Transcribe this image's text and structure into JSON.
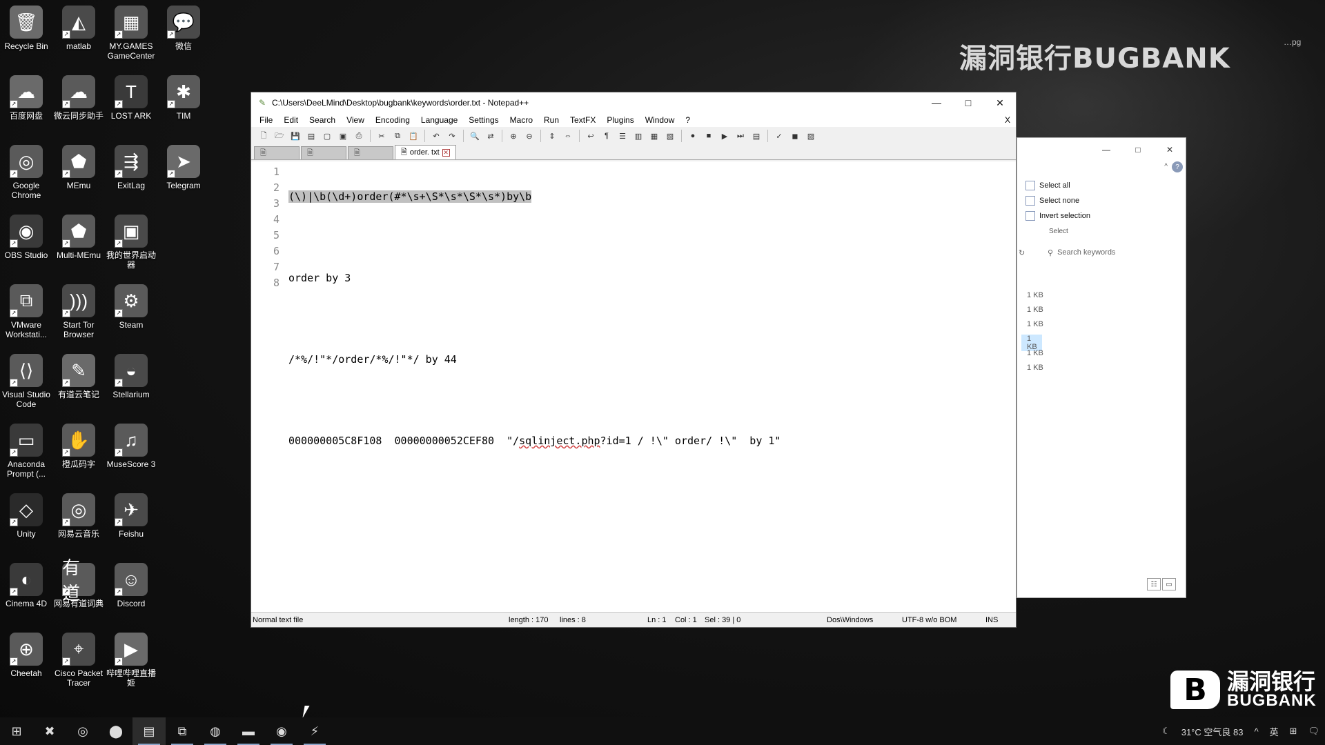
{
  "desktop": {
    "brand": "漏洞银行BUGBANK",
    "badge": "…pg",
    "icons": [
      {
        "label": "Recycle Bin",
        "icon": "recycle-bin-icon",
        "glyph": "🗑",
        "color": "#6b6b6b"
      },
      {
        "label": "matlab",
        "icon": "matlab-icon",
        "glyph": "◭",
        "color": "#4a4a4a"
      },
      {
        "label": "MY.GAMES GameCenter",
        "icon": "mygames-icon",
        "glyph": "▦",
        "color": "#555"
      },
      {
        "label": "微信",
        "icon": "wechat-icon",
        "glyph": "💬",
        "color": "#4a4a4a"
      },
      {
        "label": "百度网盘",
        "icon": "baidu-netdisk-icon",
        "glyph": "☁",
        "color": "#6a6a6a"
      },
      {
        "label": "微云同步助手",
        "icon": "weiyun-icon",
        "glyph": "☁",
        "color": "#5a5a5a"
      },
      {
        "label": "LOST ARK",
        "icon": "lost-ark-icon",
        "glyph": "T",
        "color": "#3a3a3a"
      },
      {
        "label": "TIM",
        "icon": "tim-icon",
        "glyph": "✱",
        "color": "#5a5a5a"
      },
      {
        "label": "Google Chrome",
        "icon": "chrome-icon",
        "glyph": "◎",
        "color": "#5a5a5a"
      },
      {
        "label": "MEmu",
        "icon": "memu-icon",
        "glyph": "⬟",
        "color": "#5a5a5a"
      },
      {
        "label": "ExitLag",
        "icon": "exitlag-icon",
        "glyph": "⇶",
        "color": "#4a4a4a"
      },
      {
        "label": "Telegram",
        "icon": "telegram-icon",
        "glyph": "➤",
        "color": "#6a6a6a"
      },
      {
        "label": "OBS Studio",
        "icon": "obs-icon",
        "glyph": "◉",
        "color": "#3a3a3a"
      },
      {
        "label": "Multi-MEmu",
        "icon": "multi-memu-icon",
        "glyph": "⬟",
        "color": "#5a5a5a"
      },
      {
        "label": "我的世界启动器",
        "icon": "minecraft-launcher-icon",
        "glyph": "▣",
        "color": "#4a4a4a"
      },
      {
        "label": "",
        "icon": "",
        "glyph": "",
        "color": "transparent"
      },
      {
        "label": "VMware Workstati...",
        "icon": "vmware-icon",
        "glyph": "⧉",
        "color": "#5a5a5a"
      },
      {
        "label": "Start Tor Browser",
        "icon": "tor-icon",
        "glyph": ")))",
        "color": "#4a4a4a"
      },
      {
        "label": "Steam",
        "icon": "steam-icon",
        "glyph": "⚙",
        "color": "#5a5a5a"
      },
      {
        "label": "",
        "icon": "",
        "glyph": "",
        "color": "transparent"
      },
      {
        "label": "Visual Studio Code",
        "icon": "vscode-icon",
        "glyph": "⟨⟩",
        "color": "#5a5a5a"
      },
      {
        "label": "有道云笔记",
        "icon": "youdao-note-icon",
        "glyph": "✎",
        "color": "#6a6a6a"
      },
      {
        "label": "Stellarium",
        "icon": "stellarium-icon",
        "glyph": "◒",
        "color": "#4a4a4a"
      },
      {
        "label": "",
        "icon": "",
        "glyph": "",
        "color": "transparent"
      },
      {
        "label": "Anaconda Prompt (...",
        "icon": "anaconda-icon",
        "glyph": "▭",
        "color": "#3a3a3a"
      },
      {
        "label": "橙瓜码字",
        "icon": "chenggua-icon",
        "glyph": "✋",
        "color": "#5a5a5a"
      },
      {
        "label": "MuseScore 3",
        "icon": "musescore-icon",
        "glyph": "♫",
        "color": "#5a5a5a"
      },
      {
        "label": "",
        "icon": "",
        "glyph": "",
        "color": "transparent"
      },
      {
        "label": "Unity",
        "icon": "unity-icon",
        "glyph": "◇",
        "color": "#2a2a2a"
      },
      {
        "label": "网易云音乐",
        "icon": "netease-music-icon",
        "glyph": "◎",
        "color": "#5a5a5a"
      },
      {
        "label": "Feishu",
        "icon": "feishu-icon",
        "glyph": "✈",
        "color": "#4a4a4a"
      },
      {
        "label": "",
        "icon": "",
        "glyph": "",
        "color": "transparent"
      },
      {
        "label": "Cinema 4D",
        "icon": "cinema4d-icon",
        "glyph": "◐",
        "color": "#3a3a3a"
      },
      {
        "label": "网易有道词典",
        "icon": "youdao-dict-icon",
        "glyph": "有道",
        "color": "#5a5a5a"
      },
      {
        "label": "Discord",
        "icon": "discord-icon",
        "glyph": "☺",
        "color": "#5a5a5a"
      },
      {
        "label": "",
        "icon": "",
        "glyph": "",
        "color": "transparent"
      },
      {
        "label": "Cheetah",
        "icon": "cheetah-icon",
        "glyph": "⊕",
        "color": "#5a5a5a"
      },
      {
        "label": "Cisco Packet Tracer",
        "icon": "cisco-icon",
        "glyph": "⌖",
        "color": "#4a4a4a"
      },
      {
        "label": "哔哩哔哩直播姬",
        "icon": "bilibili-live-icon",
        "glyph": "▶",
        "color": "#6a6a6a"
      }
    ]
  },
  "notepad": {
    "title": "C:\\Users\\DeeLMind\\Desktop\\bugbank\\keywords\\order.txt - Notepad++",
    "menu": [
      "File",
      "Edit",
      "Search",
      "View",
      "Encoding",
      "Language",
      "Settings",
      "Macro",
      "Run",
      "TextFX",
      "Plugins",
      "Window",
      "?"
    ],
    "menu_close": "X",
    "tabs": [
      {
        "label": "",
        "active": false
      },
      {
        "label": "",
        "active": false
      },
      {
        "label": "",
        "active": false
      },
      {
        "label": "order. txt",
        "active": true
      }
    ],
    "lines": [
      {
        "num": "1",
        "text": "(\\)|\\b(\\d+)order(#*\\s+\\S*\\s*\\S*\\s*)by\\b"
      },
      {
        "num": "2",
        "text": ""
      },
      {
        "num": "3",
        "text": "order by 3"
      },
      {
        "num": "4",
        "text": ""
      },
      {
        "num": "5",
        "text": "/*%/!\"*/order/*%/!\"*/ by 44"
      },
      {
        "num": "6",
        "text": ""
      },
      {
        "num": "7a",
        "text": "000000005C8F108  00000000052CEF80  \"/"
      },
      {
        "num": "7b",
        "text": "sqlinject.php"
      },
      {
        "num": "7c",
        "text": "?id=1 / !\\\" order/ !\\\"  by 1\""
      },
      {
        "num": "8",
        "text": ""
      }
    ],
    "status": {
      "type": "Normal text file",
      "length": "length : 170",
      "lines": "lines : 8",
      "ln": "Ln : 1",
      "col": "Col : 1",
      "sel": "Sel : 39 | 0",
      "eol": "Dos\\Windows",
      "encoding": "UTF-8 w/o BOM",
      "mode": "INS"
    }
  },
  "explorer": {
    "select_all": "Select all",
    "select_none": "Select none",
    "invert_selection": "Invert selection",
    "group": "Select",
    "search_placeholder": "Search keywords",
    "sizes": [
      "1 KB",
      "1 KB",
      "1 KB",
      "1 KB",
      "1 KB",
      "1 KB"
    ]
  },
  "taskbar": {
    "weather": "31°C  空气良 83",
    "ime": "英",
    "apps": [
      "start-icon",
      "tool-icon",
      "obs-icon",
      "record-icon",
      "notepadpp-icon",
      "vmware-icon",
      "app-icon",
      "explorer-icon",
      "game-icon",
      "unity-icon"
    ]
  },
  "watermark": {
    "cn": "漏洞银行",
    "en": "BUGBANK",
    "logo": "B"
  }
}
